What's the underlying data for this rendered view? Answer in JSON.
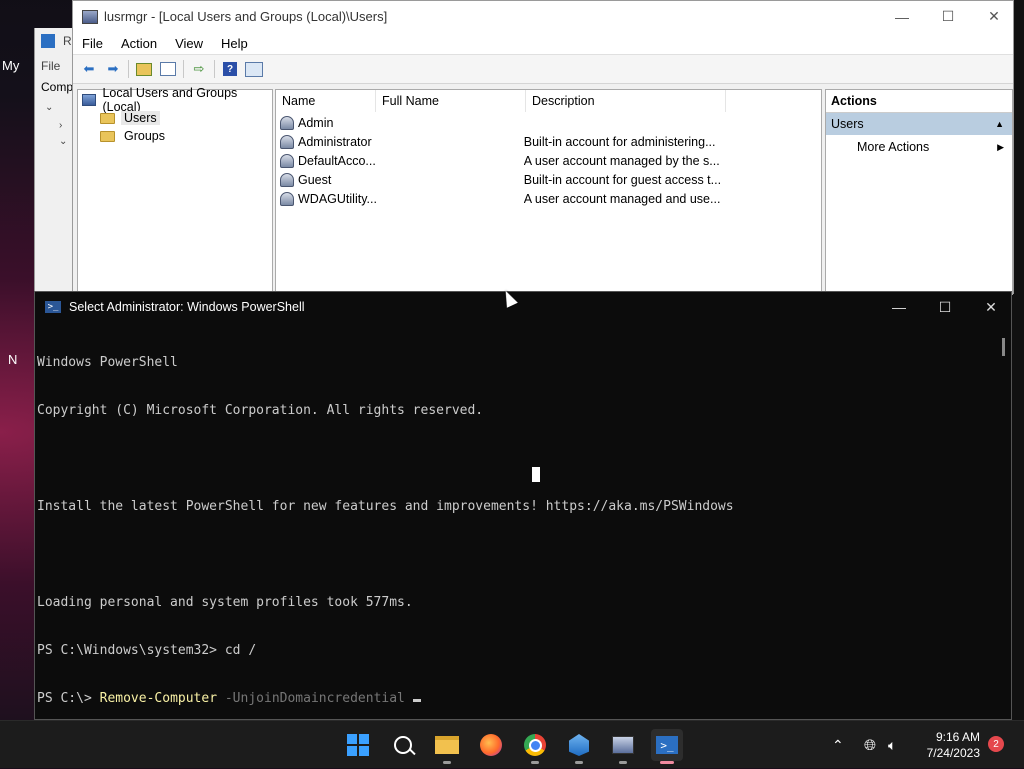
{
  "desktop": {
    "label_my": "My",
    "label_n": "N"
  },
  "bg_window": {
    "title_fragment": "R",
    "menu_file": "File",
    "tree_fragment": "Comp"
  },
  "mmc": {
    "title": "lusrmgr - [Local Users and Groups (Local)\\Users]",
    "menu": [
      "File",
      "Action",
      "View",
      "Help"
    ],
    "tree": {
      "root": "Local Users and Groups (Local)",
      "items": [
        "Users",
        "Groups"
      ],
      "selected": "Users"
    },
    "list": {
      "columns": [
        "Name",
        "Full Name",
        "Description"
      ],
      "rows": [
        {
          "name": "Admin",
          "full_name": "",
          "description": ""
        },
        {
          "name": "Administrator",
          "full_name": "",
          "description": "Built-in account for administering..."
        },
        {
          "name": "DefaultAcco...",
          "full_name": "",
          "description": "A user account managed by the s..."
        },
        {
          "name": "Guest",
          "full_name": "",
          "description": "Built-in account for guest access t..."
        },
        {
          "name": "WDAGUtility...",
          "full_name": "",
          "description": "A user account managed and use..."
        }
      ]
    },
    "actions": {
      "header": "Actions",
      "section": "Users",
      "more": "More Actions"
    }
  },
  "powershell": {
    "title": "Select Administrator: Windows PowerShell",
    "lines": [
      "Windows PowerShell",
      "Copyright (C) Microsoft Corporation. All rights reserved.",
      "",
      "Install the latest PowerShell for new features and improvements! https://aka.ms/PSWindows",
      "",
      "Loading personal and system profiles took 577ms.",
      "PS C:\\Windows\\system32> cd /"
    ],
    "prompt": "PS C:\\> ",
    "command": "Remove-Computer",
    "parameter": " -UnjoinDomaincredential"
  },
  "taskbar": {
    "apps": [
      "start-icon",
      "search-icon",
      "file-explorer-icon",
      "firefox-icon",
      "chrome-icon",
      "network-tool-icon",
      "lusrmgr-icon",
      "powershell-icon"
    ],
    "time": "9:16 AM",
    "date": "7/24/2023",
    "notification_count": "2"
  },
  "colors": {
    "ps_background": "#0c0c0c",
    "ps_command": "#f9f1a5",
    "ps_param": "#767676",
    "actions_selected": "#b9cde0",
    "taskbar": "#1c1c1c"
  }
}
